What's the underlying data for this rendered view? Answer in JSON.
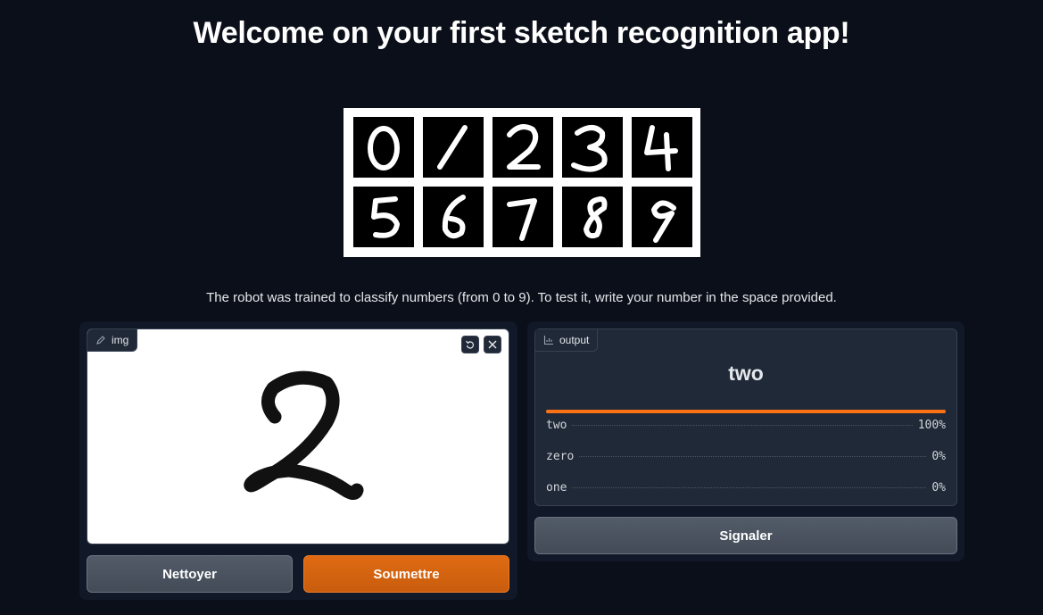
{
  "header": {
    "title": "Welcome on your first sketch recognition app!"
  },
  "digits_image": {
    "digits": [
      "0",
      "1",
      "2",
      "3",
      "4",
      "5",
      "6",
      "7",
      "8",
      "9"
    ]
  },
  "description": "The robot was trained to classify numbers (from 0 to 9). To test it, write your number in the space provided.",
  "input_panel": {
    "label": "img",
    "icon": "pencil-icon",
    "tools": [
      "undo-icon",
      "close-icon"
    ],
    "clear_label": "Nettoyer",
    "submit_label": "Soumettre"
  },
  "output_panel": {
    "label": "output",
    "icon": "chart-icon",
    "top_label": "two",
    "confidences": [
      {
        "label": "two",
        "value": "100%",
        "fraction": 1.0
      },
      {
        "label": "zero",
        "value": "0%",
        "fraction": 0.0
      },
      {
        "label": "one",
        "value": "0%",
        "fraction": 0.0
      }
    ],
    "flag_label": "Signaler"
  },
  "colors": {
    "background": "#0b0f19",
    "panel": "#111827",
    "accent": "#f97316",
    "primary_button": "#d4640f",
    "secondary_button": "#4b5563"
  }
}
